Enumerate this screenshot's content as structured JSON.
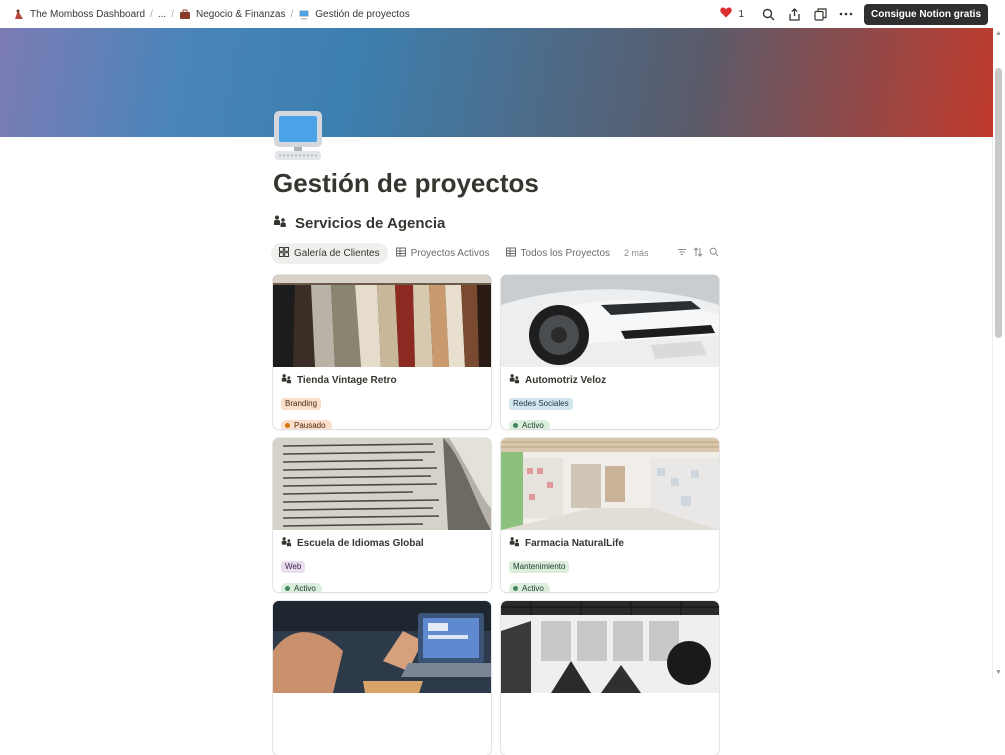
{
  "breadcrumb": [
    {
      "label": "The Momboss Dashboard",
      "icon": "momboss-logo-icon"
    },
    {
      "label": "..."
    },
    {
      "label": "Negocio & Finanzas",
      "icon": "briefcase-icon"
    },
    {
      "label": "Gestión de proyectos",
      "icon": "computer-icon"
    }
  ],
  "topbar": {
    "like_count": "1",
    "cta_label": "Consigue Notion gratis"
  },
  "page": {
    "title": "Gestión de proyectos",
    "section_title": "Servicios de Agencia"
  },
  "views": {
    "tabs": [
      {
        "label": "Galería de Clientes",
        "icon": "gallery-icon",
        "active": true
      },
      {
        "label": "Proyectos Activos",
        "icon": "table-icon",
        "active": false
      },
      {
        "label": "Todos los Proyectos",
        "icon": "table-icon",
        "active": false
      }
    ],
    "more": "2 más"
  },
  "colors": {
    "cover_start": "#7d7cb5",
    "cover_end": "#c13a2c",
    "cta_bg": "#2f2f2f",
    "heart": "#d9302f"
  },
  "cards": [
    {
      "title": "Tienda Vintage Retro",
      "tag": "Branding",
      "tag_bg": "#fadec9",
      "tag_fg": "#49290e",
      "status": "Pausado",
      "status_bg": "#fadec9",
      "status_fg": "#49290e",
      "status_dot": "#d9730d",
      "image": "clothing-rack"
    },
    {
      "title": "Automotriz Veloz",
      "tag": "Redes Sociales",
      "tag_bg": "#d3e5ef",
      "tag_fg": "#183347",
      "status": "Activo",
      "status_bg": "#dbeddb",
      "status_fg": "#1c3829",
      "status_dot": "#448361",
      "image": "white-car"
    },
    {
      "title": "Escuela de Idiomas Global",
      "tag": "Web",
      "tag_bg": "#e8deee",
      "tag_fg": "#412454",
      "status": "Activo",
      "status_bg": "#dbeddb",
      "status_fg": "#1c3829",
      "status_dot": "#448361",
      "image": "open-book"
    },
    {
      "title": "Farmacia NaturalLife",
      "tag": "Mantenimiento",
      "tag_bg": "#dbeddb",
      "tag_fg": "#1c3829",
      "status": "Activo",
      "status_bg": "#dbeddb",
      "status_fg": "#1c3829",
      "status_dot": "#448361",
      "image": "pharmacy-interior"
    },
    {
      "title": "",
      "tag": "",
      "status": "",
      "image": "laptop-meeting"
    },
    {
      "title": "",
      "tag": "",
      "status": "",
      "image": "gym-interior"
    }
  ]
}
